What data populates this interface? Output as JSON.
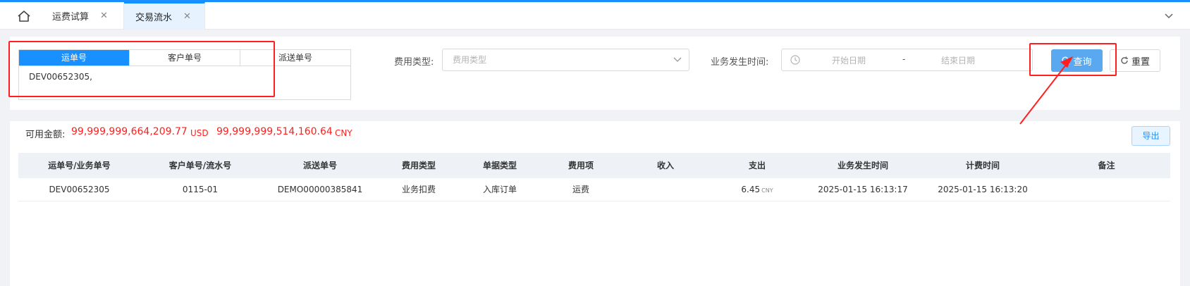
{
  "tabs": [
    {
      "label": "运费试算"
    },
    {
      "label": "交易流水"
    }
  ],
  "search": {
    "segments": [
      "运单号",
      "客户单号",
      "派送单号"
    ],
    "textarea_value": "DEV00652305,",
    "fee_type_label": "费用类型:",
    "fee_type_placeholder": "费用类型",
    "biz_time_label": "业务发生时间:",
    "start_placeholder": "开始日期",
    "range_sep": "-",
    "end_placeholder": "结束日期",
    "query_label": "查询",
    "reset_label": "重置"
  },
  "balance": {
    "label": "可用金额:",
    "usd_amount": "99,999,999,664,209.77",
    "usd_unit": "USD",
    "cny_amount": "99,999,999,514,160.64",
    "cny_unit": "CNY",
    "amount_color": "#ff1f1f"
  },
  "export_label": "导出",
  "table": {
    "columns": [
      "运单号/业务单号",
      "客户单号/流水号",
      "派送单号",
      "费用类型",
      "单据类型",
      "费用项",
      "收入",
      "支出",
      "业务发生时间",
      "计费时间",
      "备注"
    ],
    "rows": [
      {
        "waybill": "DEV00652305",
        "customer_no": "0115-01",
        "delivery_no": "DEMO00000385841",
        "fee_type": "业务扣费",
        "doc_type": "入库订单",
        "fee_item": "运费",
        "income": "",
        "expense": "6.45",
        "expense_unit": "CNY",
        "biz_time": "2025-01-15 16:13:17",
        "bill_time": "2025-01-15 16:13:20",
        "remark": ""
      }
    ]
  },
  "colors": {
    "accent": "#1890ff",
    "annotation": "#ff1f1f"
  },
  "icons": [
    "home-icon",
    "close-icon",
    "chevron-down-icon",
    "clock-icon",
    "search-icon",
    "refresh-icon"
  ]
}
